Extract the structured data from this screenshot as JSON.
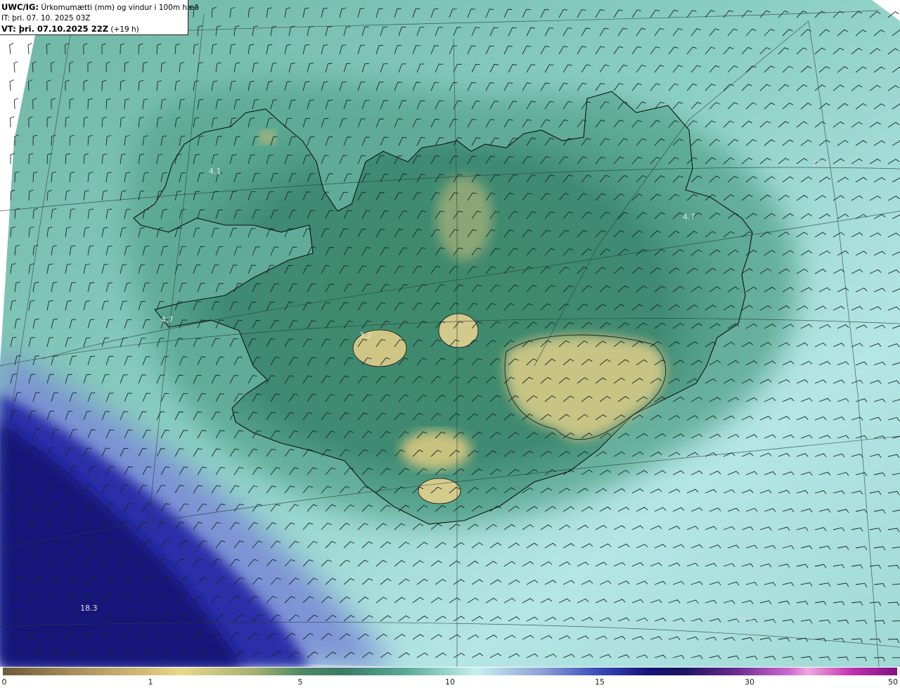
{
  "header": {
    "model": "UWC/IG:",
    "description": "Úrkomumætti (mm) og vindur i 100m hæð",
    "it_line": "IT: þri. 07. 10. 2025 03Z",
    "vt_line": "VT: þri. 07.10.2025 22Z",
    "vt_offset": "(+19 h)"
  },
  "map_labels": [
    {
      "text": "4.1",
      "style": "normal"
    },
    {
      "text": "4.7",
      "style": "normal"
    },
    {
      "text": "4.7",
      "style": "normal"
    },
    {
      "text": "3.2",
      "style": "normal"
    },
    {
      "text": "10.6",
      "style": "faint"
    },
    {
      "text": "18.3",
      "style": "normal"
    },
    {
      "text": "18.9",
      "style": "faint"
    }
  ],
  "colorbar": {
    "ticks": [
      "0",
      "1",
      "5",
      "10",
      "15",
      "30",
      "50"
    ]
  },
  "colors": {
    "ocean_teal": "#8fd0c8",
    "land_green": "#3c7f68",
    "glacier_yellow": "#cbc683",
    "heavy_precip_blue": "#1a1a8a",
    "coastline": "#111111"
  }
}
